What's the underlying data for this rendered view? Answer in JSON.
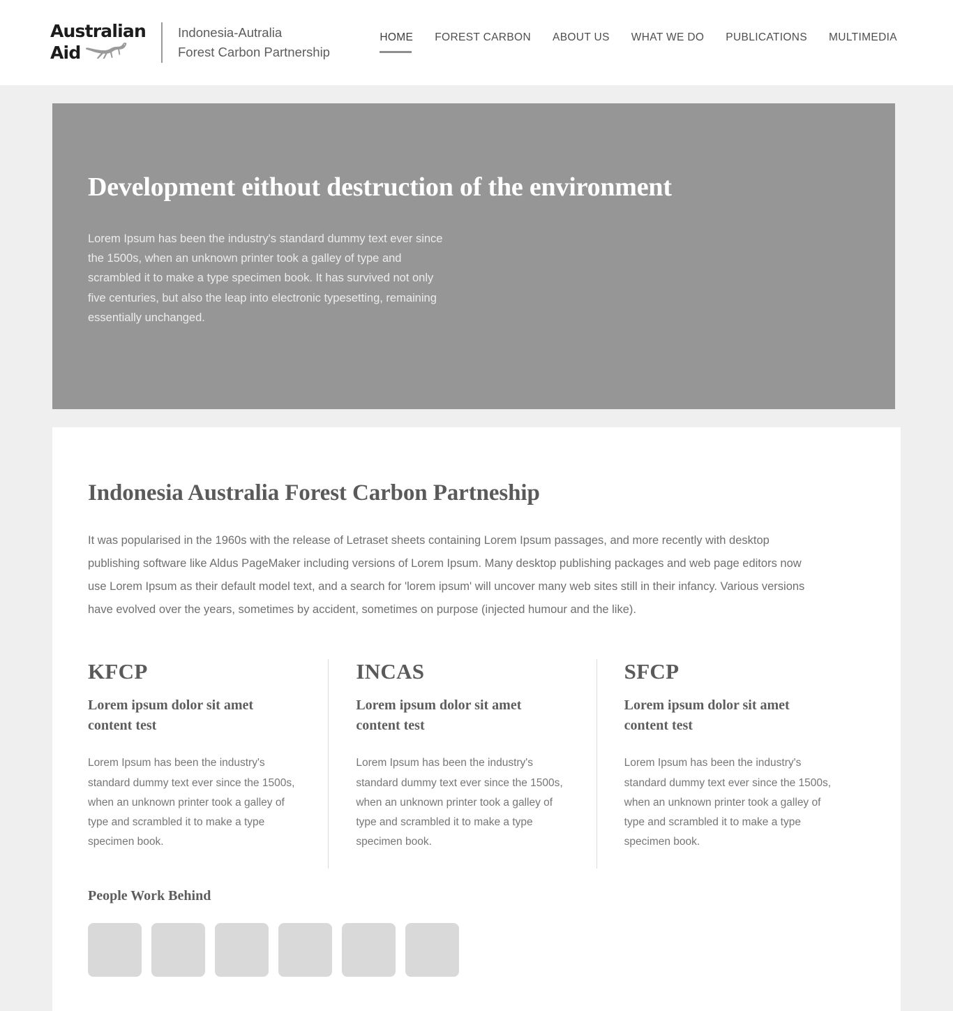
{
  "header": {
    "logo": {
      "line1": "Australian",
      "line2": "Aid",
      "icon": "kangaroo-icon"
    },
    "site_title_line1": "Indonesia-Autralia",
    "site_title_line2": "Forest Carbon Partnership",
    "nav": [
      {
        "label": "HOME",
        "active": true
      },
      {
        "label": "FOREST CARBON",
        "active": false
      },
      {
        "label": "ABOUT US",
        "active": false
      },
      {
        "label": "WHAT WE DO",
        "active": false
      },
      {
        "label": "PUBLICATIONS",
        "active": false
      },
      {
        "label": "MULTIMEDIA",
        "active": false
      }
    ]
  },
  "hero": {
    "title": "Development eithout destruction of the environment",
    "text": "Lorem Ipsum has been the industry's standard dummy text ever since the 1500s, when an unknown printer took a galley of type and scrambled it to make a type specimen book. It has survived not only five centuries, but also the leap into electronic typesetting, remaining essentially unchanged.",
    "background_color": "#969696"
  },
  "main": {
    "title": "Indonesia Australia Forest Carbon Partneship",
    "body": "It was popularised in the 1960s with the release of Letraset sheets containing Lorem Ipsum passages, and more recently with desktop publishing software like Aldus PageMaker including versions of Lorem Ipsum. Many desktop publishing packages and web page editors now use Lorem Ipsum as their default model text, and a search for 'lorem ipsum' will uncover many web sites still in their infancy. Various versions have evolved over the years, sometimes by accident, sometimes on purpose (injected humour and the like).",
    "columns": [
      {
        "title": "KFCP",
        "subtitle": "Lorem ipsum dolor sit amet content test",
        "text": "Lorem Ipsum has been the industry's standard dummy text ever since the 1500s, when an unknown printer took a galley of type and scrambled it to make a type specimen book."
      },
      {
        "title": "INCAS",
        "subtitle": "Lorem ipsum dolor sit amet content test",
        "text": "Lorem Ipsum has been the industry's standard dummy text ever since the 1500s, when an unknown printer took a galley of type and scrambled it to make a type specimen book."
      },
      {
        "title": "SFCP",
        "subtitle": "Lorem ipsum dolor sit amet content test",
        "text": "Lorem Ipsum has been the industry's standard dummy text ever since the 1500s, when an unknown printer took a galley of type and scrambled it to make a type specimen book."
      }
    ]
  },
  "people": {
    "title": "People Work Behind",
    "thumbnail_count": 6,
    "thumbnail_color": "#d9d9d9"
  },
  "theme": {
    "page_background": "#efefef",
    "card_background": "#ffffff",
    "heading_color": "#5a5a5a",
    "body_text_color": "#6f6f6f",
    "divider_color": "#dcdcdc"
  }
}
